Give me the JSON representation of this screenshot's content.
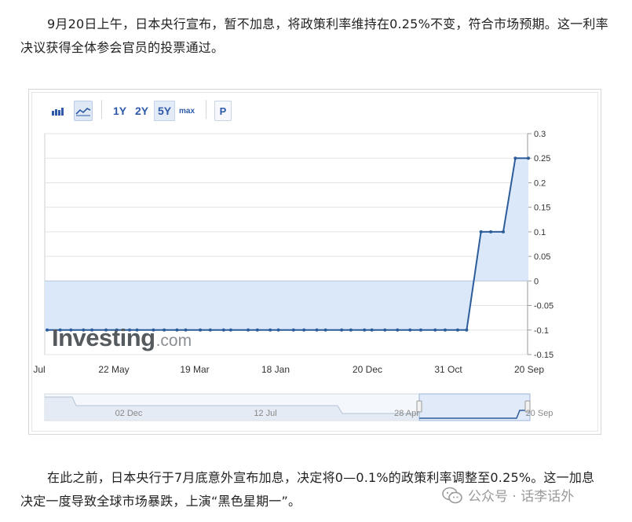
{
  "article": {
    "para1": "9月20日上午，日本央行宣布，暂不加息，将政策利率维持在0.25%不变，符合市场预期。这一利率决议获得全体参会官员的投票通过。",
    "para2": "在此之前，日本央行于7月底意外宣布加息，决定将0—0.1%的政策利率调整至0.25%。这一加息决定一度导致全球市场暴跌，上演“黑色星期一”。",
    "credit": "公众号 · 话李话外"
  },
  "toolbar": {
    "bar_icon": "bar-chart-icon",
    "line_icon": "line-chart-icon",
    "ranges": [
      "1Y",
      "2Y",
      "5Y",
      "max"
    ],
    "active_range": "5Y",
    "p_label": "P"
  },
  "watermark": {
    "brand": "Investing",
    "domain": ".com"
  },
  "colors": {
    "line": "#2c5c99",
    "fill": "#dbe8fa",
    "grid": "#e3e3e3",
    "axis_text": "#333333"
  },
  "chart_data": {
    "type": "area",
    "ylim": [
      -0.15,
      0.3
    ],
    "yticks": [
      "0.3",
      "0.25",
      "0.2",
      "0.15",
      "0.1",
      "0.05",
      "0",
      "-0.05",
      "-0.1",
      "-0.15"
    ],
    "x_ticks": [
      "Jul",
      "22 May",
      "19 Mar",
      "18 Jan",
      "20 Dec",
      "31 Oct",
      "20 Sep"
    ],
    "series": [
      {
        "x": [
          "2019-07-30",
          "2019-09-19",
          "2019-10-31",
          "2019-12-19",
          "2020-01-21",
          "2020-03-16",
          "2020-04-27",
          "2020-06-16",
          "2020-07-15",
          "2020-09-17",
          "2020-10-29",
          "2020-12-18",
          "2021-01-21",
          "2021-03-19",
          "2021-04-27",
          "2021-06-18",
          "2021-07-16",
          "2021-09-22",
          "2021-10-28",
          "2021-12-17",
          "2022-01-18",
          "2022-03-18",
          "2022-04-28",
          "2022-06-17",
          "2022-07-21",
          "2022-09-22",
          "2022-10-28",
          "2022-12-20",
          "2023-01-18",
          "2023-03-10",
          "2023-04-28",
          "2023-06-16",
          "2023-07-28",
          "2023-09-22",
          "2023-10-31",
          "2023-12-19",
          "2024-01-23",
          "2024-03-19",
          "2024-04-26",
          "2024-06-14",
          "2024-07-31",
          "2024-09-20"
        ],
        "values": [
          -0.1,
          -0.1,
          -0.1,
          -0.1,
          -0.1,
          -0.1,
          -0.1,
          -0.1,
          -0.1,
          -0.1,
          -0.1,
          -0.1,
          -0.1,
          -0.1,
          -0.1,
          -0.1,
          -0.1,
          -0.1,
          -0.1,
          -0.1,
          -0.1,
          -0.1,
          -0.1,
          -0.1,
          -0.1,
          -0.1,
          -0.1,
          -0.1,
          -0.1,
          -0.1,
          -0.1,
          -0.1,
          -0.1,
          -0.1,
          -0.1,
          -0.1,
          -0.1,
          0.1,
          0.1,
          0.1,
          0.25,
          0.25
        ]
      }
    ],
    "navigator": {
      "ticks": [
        "02 Dec",
        "12 Jul",
        "28 Apr",
        "20 Sep"
      ]
    }
  }
}
